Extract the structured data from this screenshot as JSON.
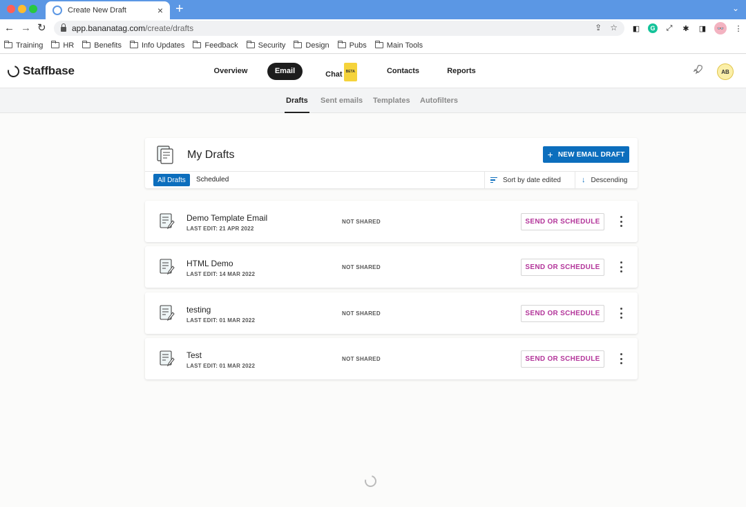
{
  "browser": {
    "tab_title": "Create New Draft",
    "new_tab": "+",
    "close": "×",
    "url_host": "app.bananatag.com",
    "url_path": "/create/drafts",
    "bookmarks": [
      "Training",
      "HR",
      "Benefits",
      "Info Updates",
      "Feedback",
      "Security",
      "Design",
      "Pubs",
      "Main Tools"
    ],
    "profile_initials": "👓"
  },
  "app": {
    "brand": "Staffbase",
    "nav": [
      {
        "label": "Overview",
        "active": false
      },
      {
        "label": "Email",
        "active": true
      },
      {
        "label": "Chat",
        "badge": "BETA",
        "active": false
      },
      {
        "label": "Contacts",
        "active": false
      },
      {
        "label": "Reports",
        "active": false
      }
    ],
    "user_initials": "AB"
  },
  "sub_nav": [
    {
      "label": "Drafts",
      "active": true
    },
    {
      "label": "Sent emails",
      "active": false
    },
    {
      "label": "Templates",
      "active": false
    },
    {
      "label": "Autofilters",
      "active": false
    }
  ],
  "panel": {
    "title": "My Drafts",
    "new_button": "NEW EMAIL DRAFT",
    "filters": [
      "All Drafts",
      "Scheduled"
    ],
    "sort_label": "Sort by date edited",
    "direction_label": "Descending"
  },
  "drafts": [
    {
      "name": "Demo Template Email",
      "last_edit": "LAST EDIT: 21 APR 2022",
      "sharing": "NOT SHARED",
      "action": "SEND OR SCHEDULE"
    },
    {
      "name": "HTML Demo",
      "last_edit": "LAST EDIT: 14 MAR 2022",
      "sharing": "NOT SHARED",
      "action": "SEND OR SCHEDULE"
    },
    {
      "name": "testing",
      "last_edit": "LAST EDIT: 01 MAR 2022",
      "sharing": "NOT SHARED",
      "action": "SEND OR SCHEDULE"
    },
    {
      "name": "Test",
      "last_edit": "LAST EDIT: 01 MAR 2022",
      "sharing": "NOT SHARED",
      "action": "SEND OR SCHEDULE"
    }
  ],
  "colors": {
    "primary": "#0c6ebd",
    "send_text": "#b3359a",
    "browser_bar": "#5b97e4"
  }
}
